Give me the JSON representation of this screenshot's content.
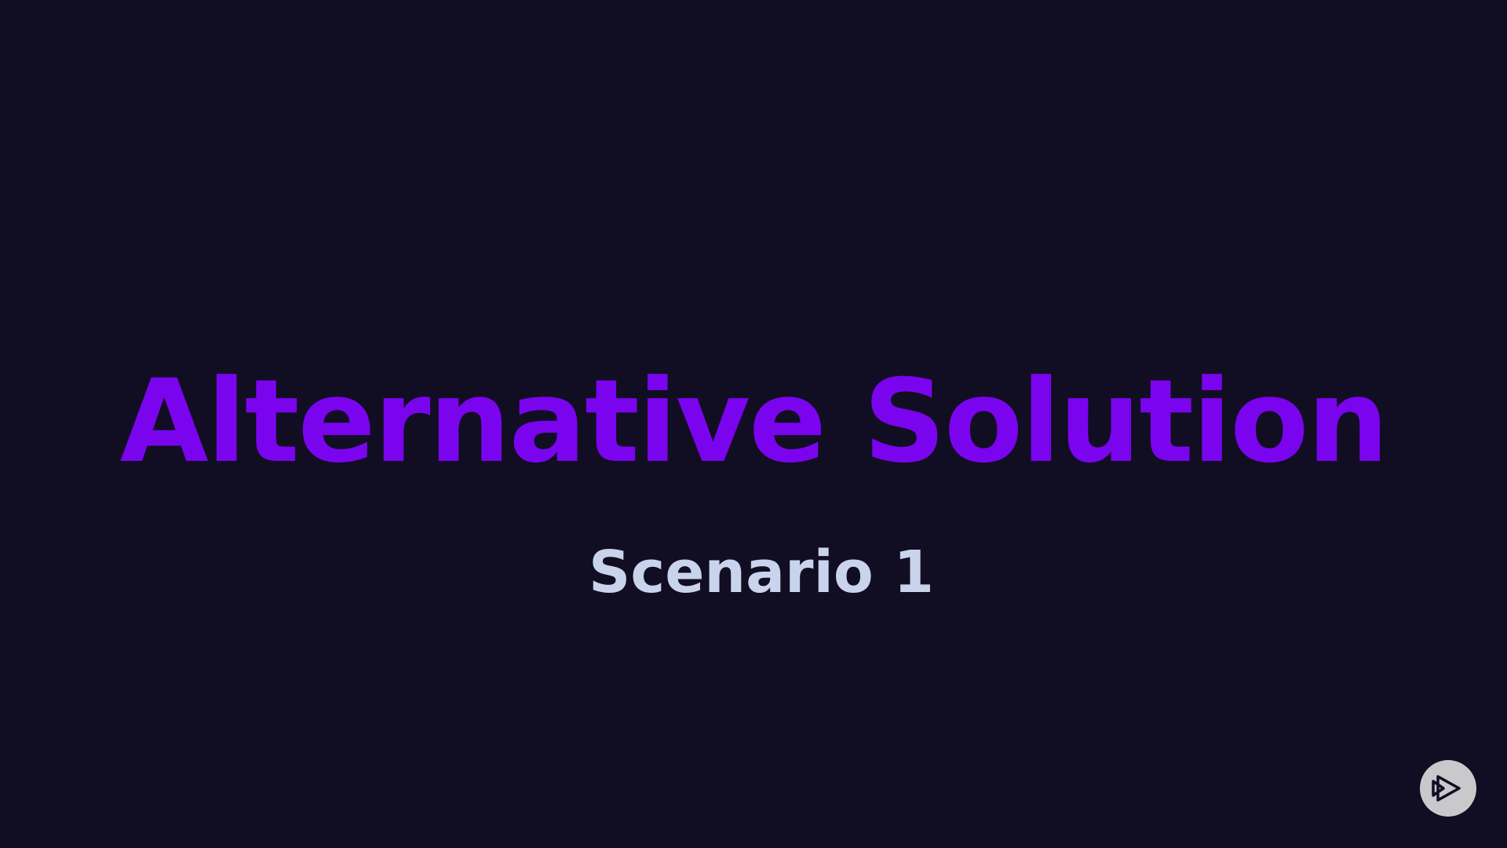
{
  "slide": {
    "title": "Alternative Solution",
    "subtitle": "Scenario 1"
  },
  "logo": {
    "icon": "play-triangle-logo-icon"
  },
  "colors": {
    "background": "#110d23",
    "title": "#7a04ee",
    "subtitle": "#c9d4ec",
    "logo_badge": "#c9c9cc",
    "logo_mark": "#110d23"
  }
}
